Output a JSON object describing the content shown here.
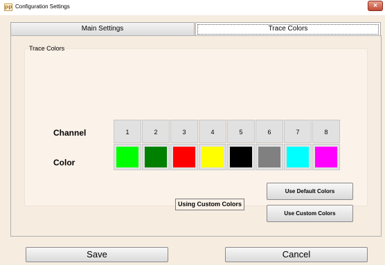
{
  "window": {
    "title": "Configuration Settings",
    "app_icon_glyph": "PP",
    "close_glyph": "×"
  },
  "tabs": [
    {
      "label": "Main Settings",
      "selected": false
    },
    {
      "label": "Trace Colors",
      "selected": true
    }
  ],
  "trace_colors": {
    "group_title": "Trace Colors",
    "channel_label": "Channel",
    "color_label": "Color",
    "channels": [
      {
        "number": "1",
        "color": "#00ff00"
      },
      {
        "number": "2",
        "color": "#008000"
      },
      {
        "number": "3",
        "color": "#ff0000"
      },
      {
        "number": "4",
        "color": "#ffff00"
      },
      {
        "number": "5",
        "color": "#000000"
      },
      {
        "number": "6",
        "color": "#808080"
      },
      {
        "number": "7",
        "color": "#00ffff"
      },
      {
        "number": "8",
        "color": "#ff00ff"
      }
    ],
    "status_text": "Using Custom Colors",
    "default_button": "Use Default Colors",
    "custom_button": "Use Custom Colors"
  },
  "footer": {
    "save_label": "Save",
    "cancel_label": "Cancel"
  }
}
